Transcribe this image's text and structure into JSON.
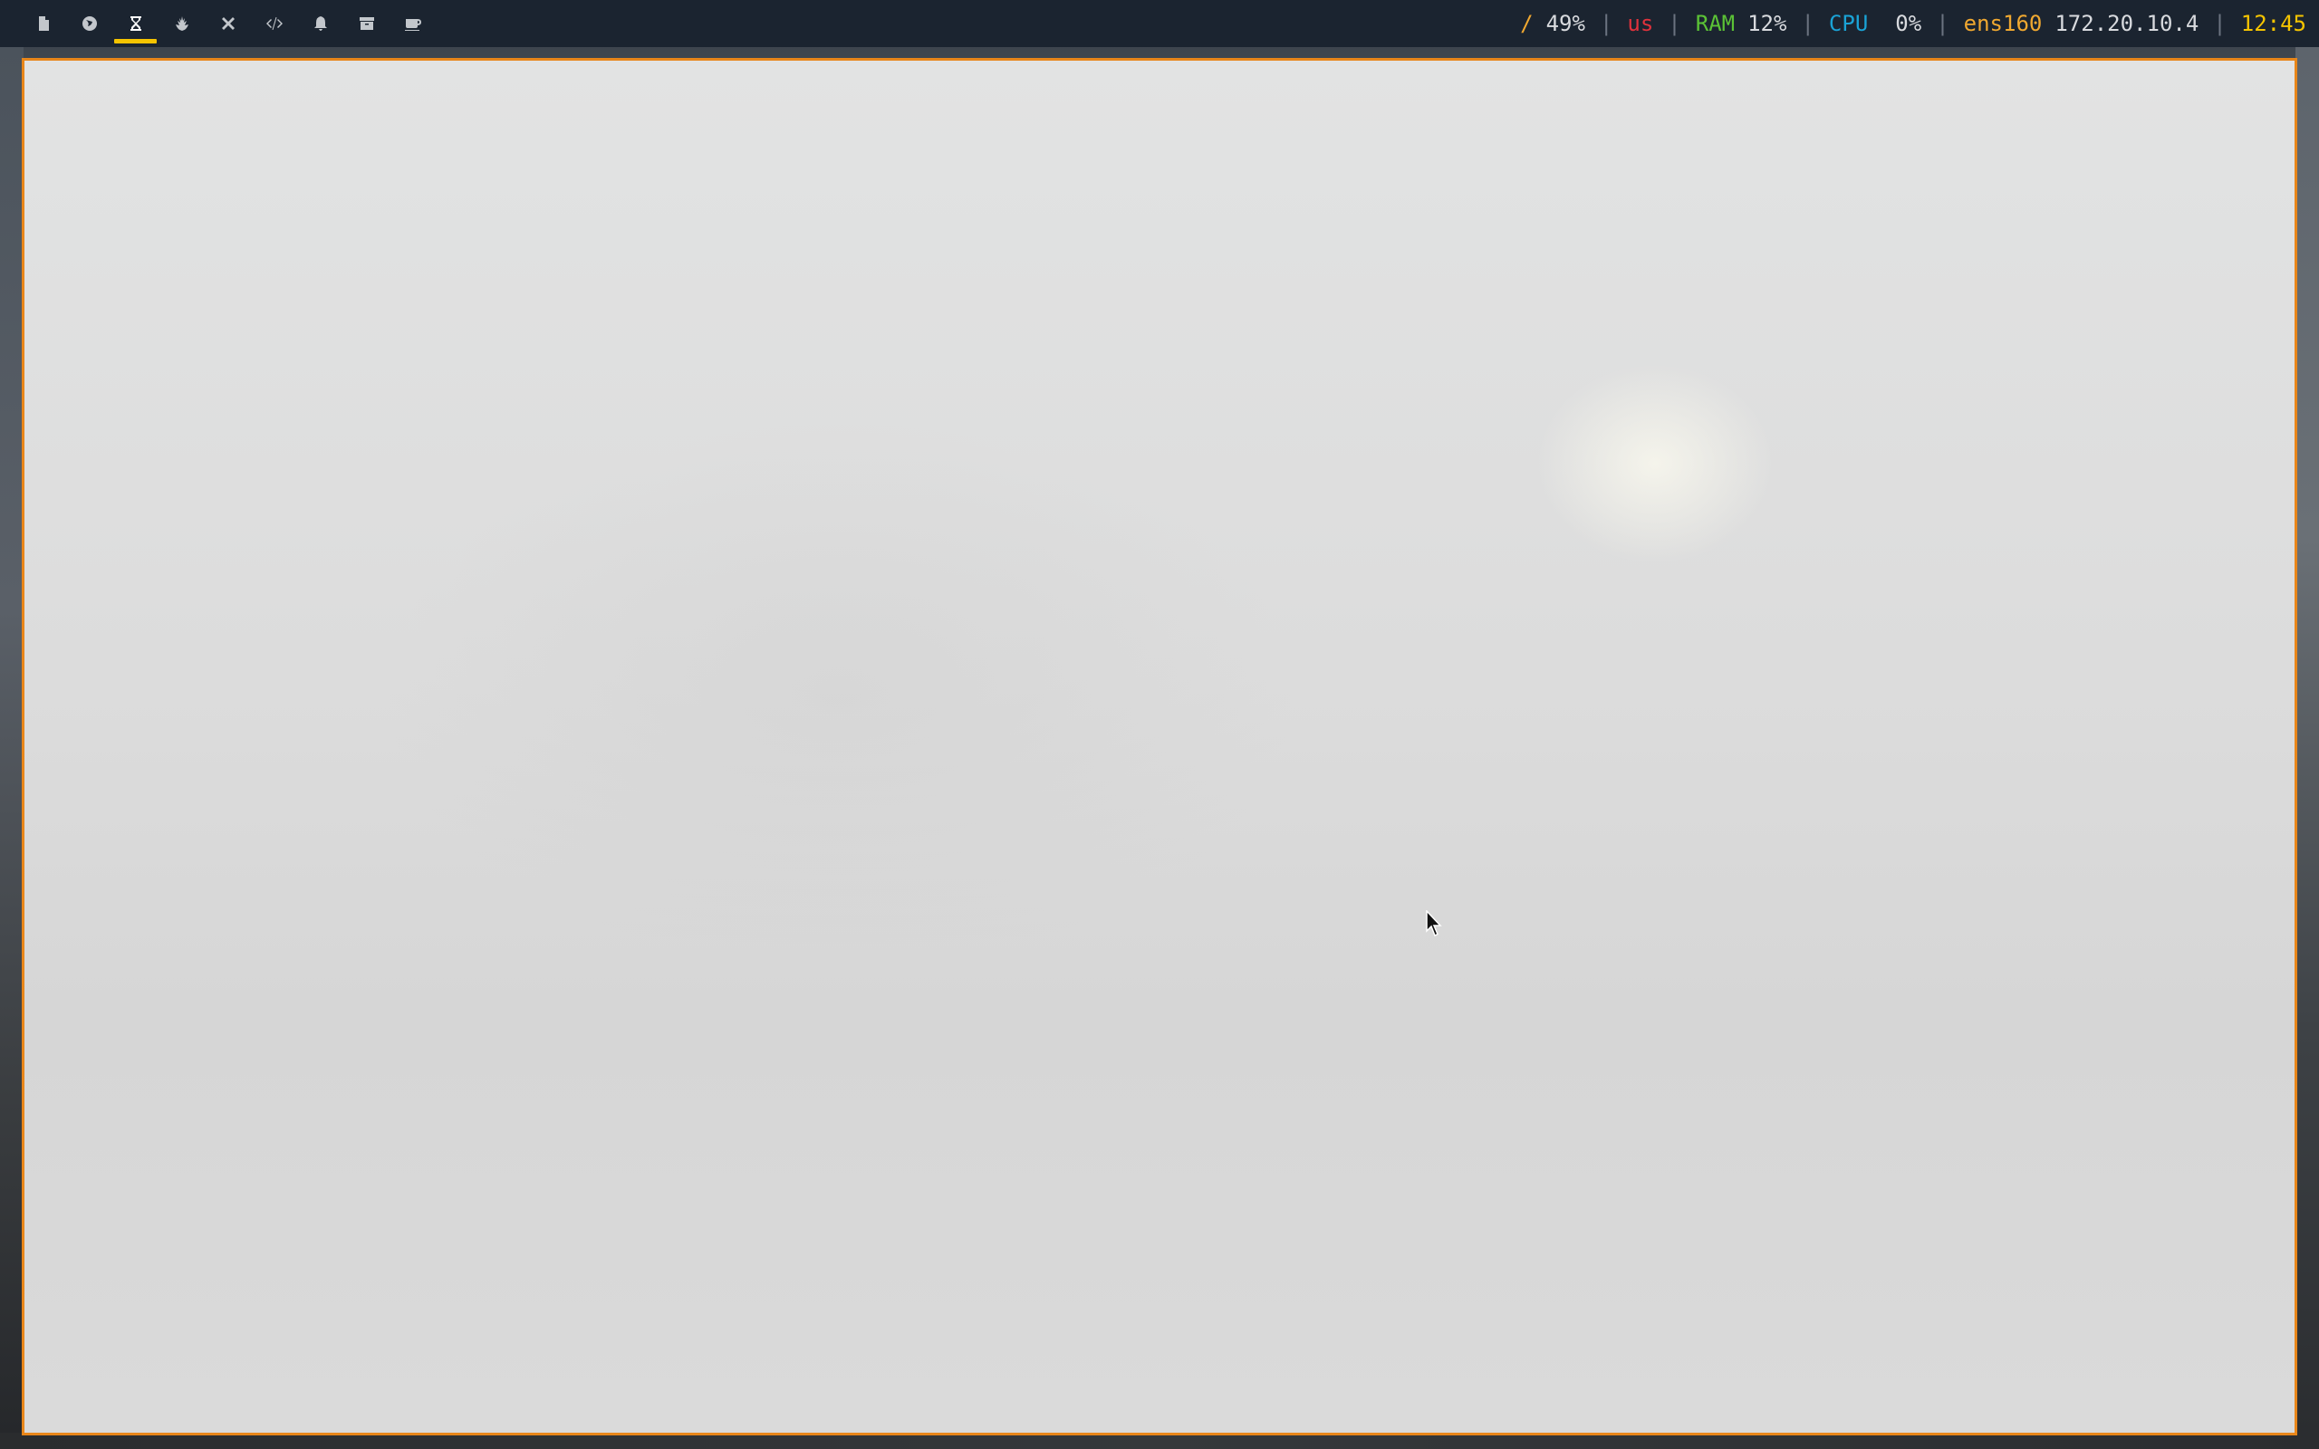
{
  "workspaces": [
    {
      "icon": "file-icon",
      "active": false
    },
    {
      "icon": "globe-icon",
      "active": false
    },
    {
      "icon": "hourglass-icon",
      "active": true
    },
    {
      "icon": "rebel-icon",
      "active": false
    },
    {
      "icon": "cross-icon",
      "active": false
    },
    {
      "icon": "code-icon",
      "active": false
    },
    {
      "icon": "bell-icon",
      "active": false
    },
    {
      "icon": "archive-icon",
      "active": false
    },
    {
      "icon": "coffee-icon",
      "active": false
    }
  ],
  "status": {
    "disk": {
      "label": "/",
      "value": "49%",
      "color": "#f0a830"
    },
    "keyboard": {
      "value": "us",
      "color": "#e0323c"
    },
    "ram": {
      "label": "RAM",
      "value": "12%",
      "color": "#5bc236"
    },
    "cpu": {
      "label": "CPU",
      "value": "0%",
      "color": "#1aa3d6"
    },
    "network": {
      "interface": "ens160",
      "ip": "172.20.10.4",
      "color": "#f0a830"
    },
    "clock": {
      "time": "12:45",
      "color": "#f5c400"
    },
    "separator": "|"
  },
  "colors": {
    "bar_background": "#1b2430",
    "window_border": "#e8861a",
    "active_workspace_indicator": "#f5c400"
  }
}
